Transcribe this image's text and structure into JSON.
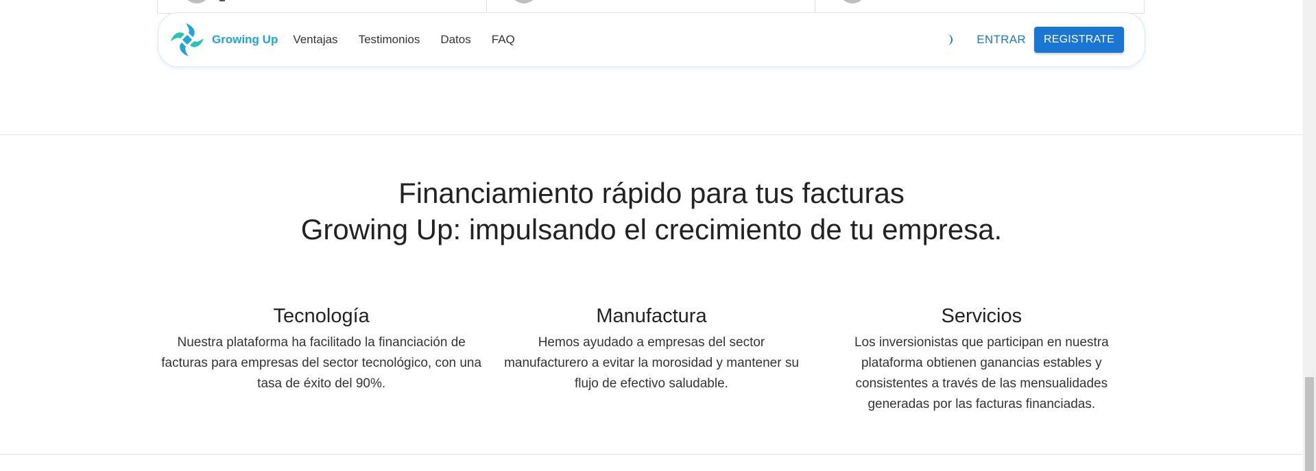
{
  "navbar": {
    "brand_name": "Growing Up",
    "links": [
      "Ventajas",
      "Testimonios",
      "Datos",
      "FAQ"
    ],
    "theme_toggle_icon": "moon-icon",
    "login_label": "ENTRAR",
    "register_label": "REGISTRATE"
  },
  "hero": {
    "line1": "Financiamiento rápido para tus facturas",
    "line2": "Growing Up: impulsando el crecimiento de tu empresa."
  },
  "features": [
    {
      "title": "Tecnología",
      "text": "Nuestra plataforma ha facilitado la financiación de facturas para empresas del sector tecnológico, con una tasa de éxito del 90%."
    },
    {
      "title": "Manufactura",
      "text": "Hemos ayudado a empresas del sector manufacturero a evitar la morosidad y mantener su flujo de efectivo saludable."
    },
    {
      "title": "Servicios",
      "text": "Los inversionistas que participan en nuestra plataforma obtienen ganancias estables y consistentes a través de las mensualidades generadas por las facturas financiadas."
    }
  ],
  "colors": {
    "brand_teal": "#1ea5d8",
    "primary_blue": "#1976d2"
  }
}
